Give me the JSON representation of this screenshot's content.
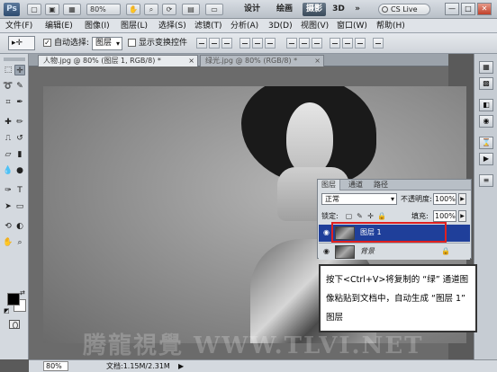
{
  "appbar": {
    "logo": "Ps",
    "zoom": "80%",
    "workspaces": [
      "设计",
      "绘画",
      "摄影",
      "3D"
    ],
    "more": "»",
    "cslive": "CS Live",
    "window_controls": [
      "—",
      "□",
      "✕"
    ]
  },
  "menu": [
    "文件(F)",
    "编辑(E)",
    "图像(I)",
    "图层(L)",
    "选择(S)",
    "滤镜(T)",
    "分析(A)",
    "3D(D)",
    "视图(V)",
    "窗口(W)",
    "帮助(H)"
  ],
  "options": {
    "auto_select_label": "自动选择:",
    "auto_select_value": "图层",
    "show_transform_label": "显示变换控件"
  },
  "tabs": [
    {
      "label": "人物.jpg @ 80% (图层 1, RGB/8) *",
      "close": "×"
    },
    {
      "label": "绿光.jpg @ 80% (RGB/8) *",
      "close": "×"
    }
  ],
  "layers_panel": {
    "tabs": [
      "图层",
      "通道",
      "路径"
    ],
    "blend_mode": "正常",
    "opacity_label": "不透明度:",
    "opacity_value": "100%",
    "lock_label": "锁定:",
    "fill_label": "填充:",
    "fill_value": "100%",
    "layers": [
      {
        "name": "图层 1",
        "selected": true
      },
      {
        "name": "背景",
        "selected": false
      }
    ]
  },
  "callout": {
    "text": "按下<Ctrl+V>将复制的 “绿” 通道图像粘贴到文档中，自动生成 “图层 1” 图层"
  },
  "status": {
    "zoom": "80%",
    "doc_info": "文档:1.15M/2.31M"
  },
  "watermark": "腾龍視覺 WWW.TLVI.NET",
  "colors": {
    "foreground": "#000000",
    "background": "#ffffff",
    "selected_layer": "#1f3f9a",
    "highlight_box": "#e02020"
  }
}
